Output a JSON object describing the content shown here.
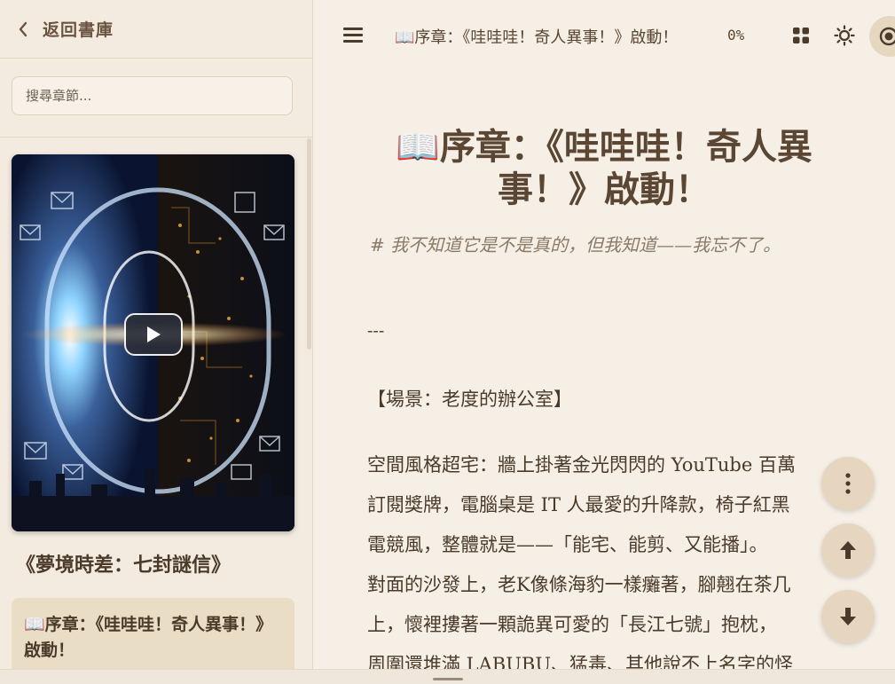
{
  "sidebar": {
    "back_label": "返回書庫",
    "search_placeholder": "搜尋章節...",
    "book_title": "《夢境時差：七封謎信》",
    "chapters": [
      {
        "label_line1": "📖序章：《哇哇哇！奇人異事！》",
        "label_line2": "啟動！"
      }
    ]
  },
  "header": {
    "title": "📖序章：《哇哇哇！奇人異事！》啟動！",
    "progress": "0%"
  },
  "main": {
    "heading_line1": "📖序章：《哇哇哇！奇人異",
    "heading_line2": "事！》啟動！",
    "subtitle": "# 我不知道它是不是真的，但我知道——我忘不了。",
    "divider": "---",
    "scene": "【場景：老度的辦公室】",
    "paragraph_lines": [
      "空間風格超宅：牆上掛著金光閃閃的 YouTube 百萬",
      "訂閱獎牌，電腦桌是 IT 人最愛的升降款，椅子紅黑",
      "電競風，整體就是——「能宅、能剪、又能播」。",
      "對面的沙發上，老K像條海豹一樣癱著，腳翹在茶几",
      "上，懷裡摟著一顆詭異可愛的「長江七號」抱枕，",
      "周圍還堆滿 LABUBU、猛毒、其他說不上名字的怪"
    ]
  },
  "colors": {
    "background": "#f5efe6",
    "sidebar": "#f3ebdf",
    "accent": "#e6d6bf",
    "text": "#4a3a2a"
  },
  "icons": [
    "chevron-left-icon",
    "hamburger-icon",
    "grid-icon",
    "sun-icon",
    "theme-toggle-icon",
    "more-vertical-icon",
    "arrow-up-icon",
    "arrow-down-icon",
    "play-icon"
  ]
}
